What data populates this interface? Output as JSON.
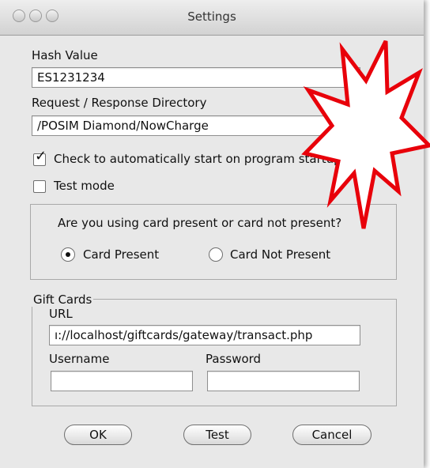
{
  "window": {
    "title": "Settings"
  },
  "hash": {
    "label": "Hash Value",
    "value": "ES1231234"
  },
  "directory": {
    "label": "Request / Response Directory",
    "value": "/POSIM Diamond/NowCharge",
    "browse_label": "..."
  },
  "autostart": {
    "label": "Check to automatically start on program startup.",
    "checked": true
  },
  "testmode": {
    "label": "Test mode",
    "checked": false
  },
  "card_mode": {
    "question": "Are you using card present or card not present?",
    "options": [
      {
        "label": "Card Present",
        "selected": true
      },
      {
        "label": "Card Not Present",
        "selected": false
      }
    ]
  },
  "gift_cards": {
    "legend": "Gift Cards",
    "url_label": "URL",
    "url_value": "ı://localhost/giftcards/gateway/transact.php",
    "username_label": "Username",
    "username_value": "",
    "password_label": "Password",
    "password_value": ""
  },
  "buttons": {
    "ok": "OK",
    "test": "Test",
    "cancel": "Cancel"
  },
  "colors": {
    "starburst_outline": "#e8000a",
    "window_bg": "#e8e8e8"
  }
}
